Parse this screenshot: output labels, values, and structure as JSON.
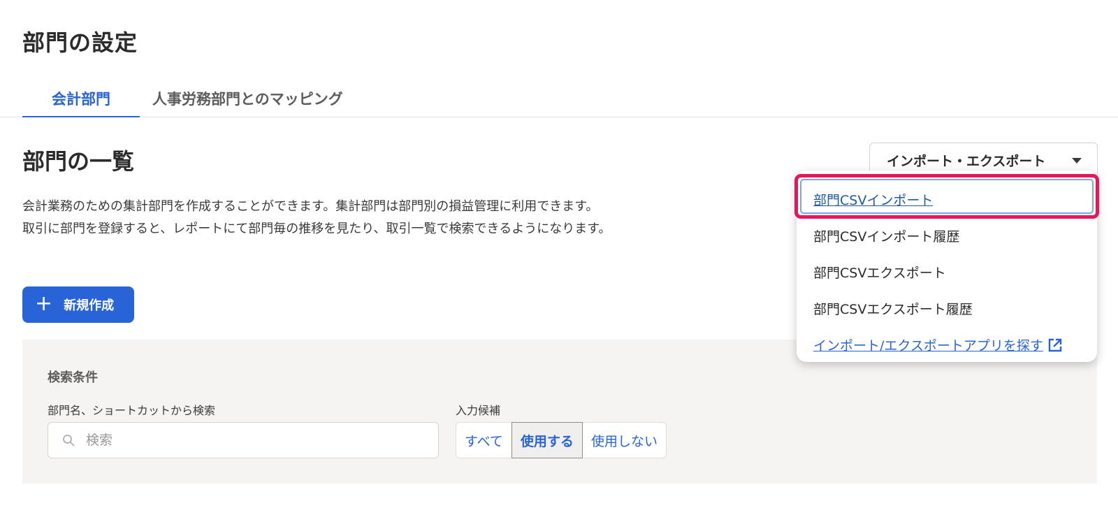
{
  "page": {
    "title": "部門の設定"
  },
  "tabs": [
    {
      "label": "会計部門",
      "active": true
    },
    {
      "label": "人事労務部門とのマッピング",
      "active": false
    }
  ],
  "section": {
    "title": "部門の一覧",
    "description_lines": [
      "会計業務のための集計部門を作成することができます。集計部門は部門別の損益管理に利用できます。",
      "取引に部門を登録すると、レポートにて部門毎の推移を見たり、取引一覧で検索できるようになります。"
    ]
  },
  "new_button": {
    "icon": "plus-icon",
    "label": "新規作成"
  },
  "import_export": {
    "button_label": "インポート・エクスポート",
    "menu_items": [
      {
        "label": "部門CSVインポート",
        "highlighted": true
      },
      {
        "label": "部門CSVインポート履歴"
      },
      {
        "label": "部門CSVエクスポート"
      },
      {
        "label": "部門CSVエクスポート履歴"
      },
      {
        "label": "インポート/エクスポートアプリを探す",
        "icon": "external-link-icon"
      }
    ]
  },
  "search": {
    "panel_title": "検索条件",
    "name_label": "部門名、ショートカットから検索",
    "placeholder": "検索",
    "candidate_label": "入力候補",
    "options": [
      "すべて",
      "使用する",
      "使用しない"
    ],
    "selected_option": "使用する"
  },
  "colors": {
    "primary": "#2864d8",
    "highlight": "#e8155b",
    "panel_bg": "#f5f4f3"
  }
}
